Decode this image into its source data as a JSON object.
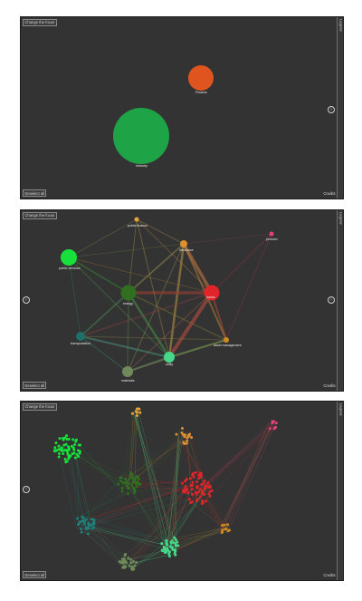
{
  "controls": {
    "change_focus": "Change the focus",
    "deselect_all": "Deselect all",
    "credits": "Credits",
    "legend": "Legend",
    "prev_icon": "chevron-left-icon",
    "next_icon": "chevron-right-icon"
  },
  "panel1": {
    "nodes": [
      {
        "label": "Finance",
        "color": "#e0541f"
      },
      {
        "label": "Industry",
        "color": "#1fa347"
      }
    ]
  },
  "panel2": {
    "nodes": [
      {
        "label": "public finance",
        "color": "#e8a43a"
      },
      {
        "label": "pension",
        "color": "#e0437a"
      },
      {
        "label": "public services",
        "color": "#18e03a"
      },
      {
        "label": "insurance",
        "color": "#e09030"
      },
      {
        "label": "energy",
        "color": "#2f6f1f"
      },
      {
        "label": "banks",
        "color": "#e0242a"
      },
      {
        "label": "transportation",
        "color": "#1f6f6a"
      },
      {
        "label": "asset management",
        "color": "#d08a20"
      },
      {
        "label": "utility",
        "color": "#46d98a"
      },
      {
        "label": "materials",
        "color": "#6f8a5a"
      }
    ]
  },
  "colors": {
    "panel_background": "#333333",
    "page_background": "#ffffff"
  }
}
